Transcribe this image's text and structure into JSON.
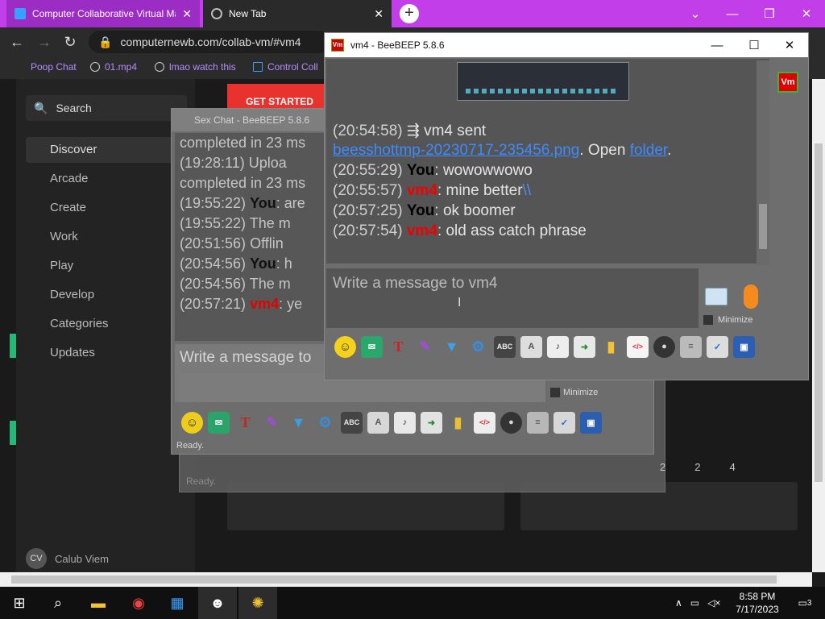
{
  "browser": {
    "tabs": [
      {
        "title": "Computer Collaborative Virtual Ma",
        "color": "#9b2cc4"
      },
      {
        "title": "New Tab",
        "color": "#2a2a2a"
      }
    ],
    "url": "computernewb.com/collab-vm/#vm4",
    "bookmarks": [
      "Poop Chat",
      "01.mp4",
      "lmao watch this",
      "Control Coll"
    ],
    "accent": "#c13ee8"
  },
  "site": {
    "search_label": "Search",
    "nav": [
      "Discover",
      "Arcade",
      "Create",
      "Work",
      "Play",
      "Develop",
      "Categories",
      "Updates"
    ],
    "get_started": "GET STARTED",
    "user_initials": "CV",
    "user_name": "Calub Viem"
  },
  "back_window": {
    "title": "Sex Chat - BeeBEEP 5.8.6",
    "lines": [
      {
        "ts": "",
        "text": "completed in 23 ms"
      },
      {
        "ts": "(19:28:11)",
        "text": "Uploa"
      },
      {
        "ts": "",
        "text": "completed in 23 ms"
      },
      {
        "ts": "(19:55:22)",
        "who": "You",
        "text": ": are"
      },
      {
        "ts": "(19:55:22)",
        "text": "The m"
      },
      {
        "ts": "(20:51:56)",
        "text": "Offlin"
      },
      {
        "ts": "(20:54:56)",
        "who": "You",
        "text": ": h"
      },
      {
        "ts": "(20:54:56)",
        "text": "The m"
      },
      {
        "ts": "(20:57:21)",
        "who_red": "vm4",
        "text": ": ye"
      }
    ],
    "input_placeholder": "Write a message to",
    "minimize": "Minimize",
    "status": "Ready."
  },
  "ghost_window": {
    "status": "Ready.",
    "counts": [
      "2",
      "2",
      "4"
    ]
  },
  "vm_window": {
    "title": "vm4 - BeeBEEP 5.8.6",
    "side_badge": "Vm",
    "messages": [
      {
        "ts": "(20:54:58)",
        "text": "vm4 sent"
      },
      {
        "link": "beesshottmp-20230717-235456.png",
        "mid": ". Open ",
        "link2": "folder",
        "end": "."
      },
      {
        "ts": "(20:55:29)",
        "who": "You",
        "text": ": wowowwowo"
      },
      {
        "ts": "(20:55:57)",
        "who_red": "vm4",
        "text": ": mine better",
        "tail": "\\\\"
      },
      {
        "ts": "(20:57:25)",
        "who": "You",
        "text": ": ok boomer"
      },
      {
        "ts": "(20:57:54)",
        "who_red": "vm4",
        "text": ": old ass catch phrase"
      }
    ],
    "input_placeholder": "Write a message to vm4",
    "minimize": "Minimize",
    "tools": [
      "emoji-icon",
      "mail-icon",
      "font-icon",
      "pen-icon",
      "filter-icon",
      "gear-icon",
      "spellcheck-icon",
      "doc-icon",
      "note-icon",
      "send-file-icon",
      "folder-icon",
      "code-icon",
      "camera-icon",
      "lines-icon",
      "checklist-icon",
      "window-icon"
    ]
  },
  "taskbar": {
    "time": "8:58 PM",
    "date": "7/17/2023",
    "notifications": "3"
  }
}
